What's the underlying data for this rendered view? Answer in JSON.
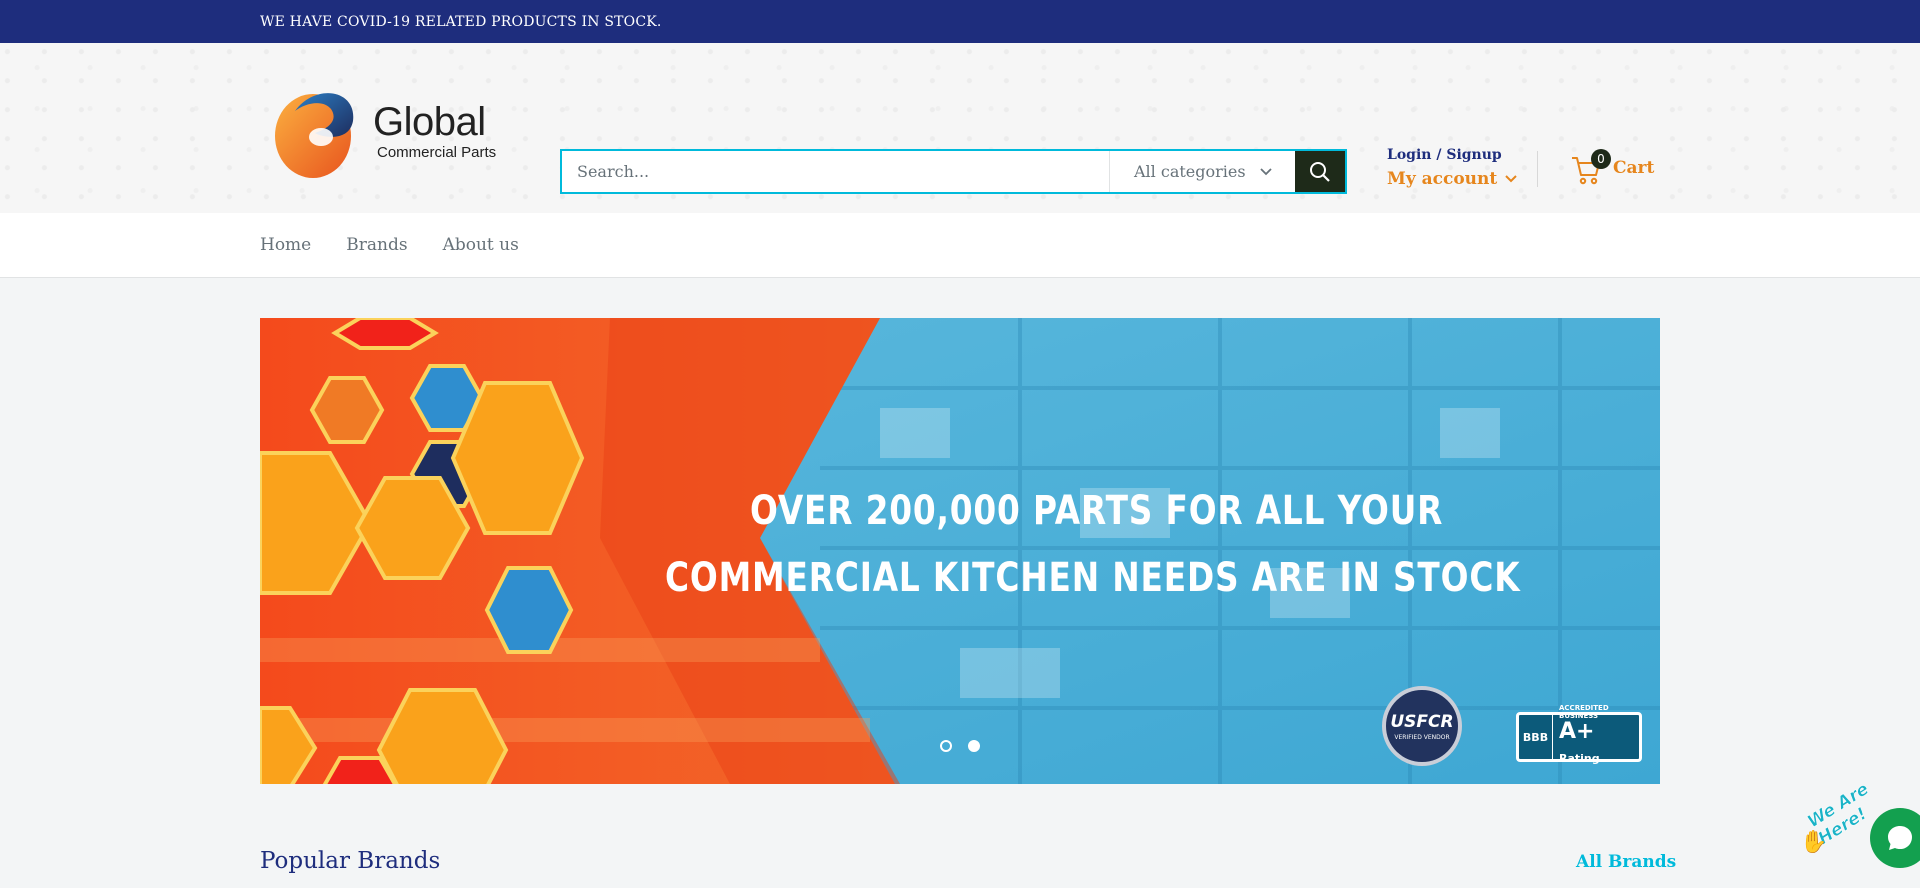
{
  "announcement": {
    "text": "WE HAVE COVID-19 RELATED PRODUCTS IN STOCK."
  },
  "header": {
    "logo": {
      "title": "Global",
      "subtitle": "Commercial Parts"
    },
    "search": {
      "placeholder": "Search...",
      "category_label": "All categories"
    },
    "account": {
      "login_label": "Login / Signup",
      "my_account_label": "My account"
    },
    "cart": {
      "count": "0",
      "label": "Cart"
    }
  },
  "nav": {
    "items": [
      {
        "label": "Home"
      },
      {
        "label": "Brands"
      },
      {
        "label": "About us"
      }
    ]
  },
  "banner": {
    "line1": "OVER 200,000 PARTS FOR ALL YOUR",
    "line2": "COMMERCIAL KITCHEN  NEEDS ARE IN STOCK",
    "slides_total": 2,
    "active_slide": 2,
    "usfcr_badge": {
      "main": "USFCR",
      "sub": "VERIFIED VENDOR"
    },
    "bbb_badge": {
      "logo": "BBB",
      "top": "ACCREDITED BUSINESS",
      "rating": "A+",
      "rating_word": "Rating"
    }
  },
  "section": {
    "title": "Popular Brands",
    "link": "All Brands"
  },
  "chat": {
    "tagline": "We Are Here!",
    "icon": "chat-bubble-icon"
  },
  "colors": {
    "primary": "#1e2d7d",
    "accent": "#e6861d",
    "link": "#00badb",
    "chat": "#13a04f",
    "search_button": "#1e2a19"
  }
}
